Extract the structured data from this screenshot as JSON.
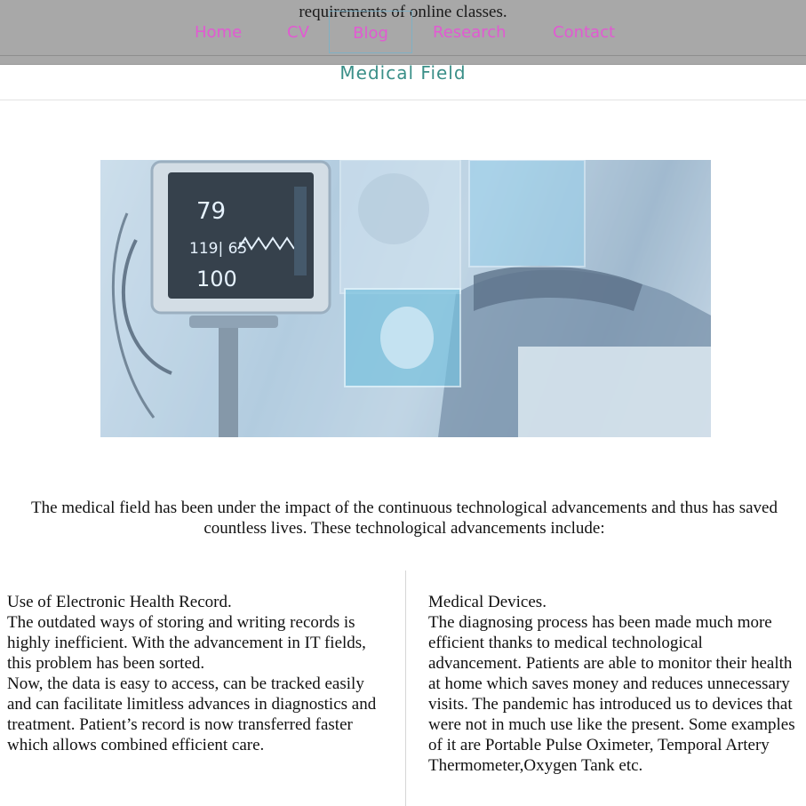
{
  "overflow_text": "requirements of online classes.",
  "nav": {
    "items": [
      "Home",
      "CV",
      "Blog",
      "Research",
      "Contact"
    ],
    "active": "Blog",
    "color": "#e15ad2"
  },
  "section": {
    "title": "Medical Field",
    "title_color": "#3a8f88"
  },
  "hero": {
    "monitor": {
      "hr": "79",
      "bp": "119| 65",
      "spo2": "100"
    },
    "icon": "medical-equipment-image"
  },
  "intro": "The medical field has been under the impact of the continuous technological advancements and thus has saved countless lives. These technological advancements include:",
  "left_column": {
    "heading": "Use of Electronic Health Record.",
    "para1": "The outdated ways of storing and writing records is highly inefficient. With the advancement in IT fields, this problem has been sorted.",
    "para2": "Now, the data is easy to access, can be tracked easily and can facilitate limitless advances in diagnostics and treatment. Patient’s record is now transferred faster which allows combined efficient care."
  },
  "right_column": {
    "heading": "Medical Devices.",
    "para1": "The diagnosing process has been made much more efficient thanks to medical technological advancement. Patients are able to monitor their health at home which saves money and reduces unnecessary visits. The pandemic has introduced us to devices that were not in much use like the present. Some examples of it are Portable Pulse Oximeter, Temporal Artery Thermometer,Oxygen Tank etc."
  }
}
